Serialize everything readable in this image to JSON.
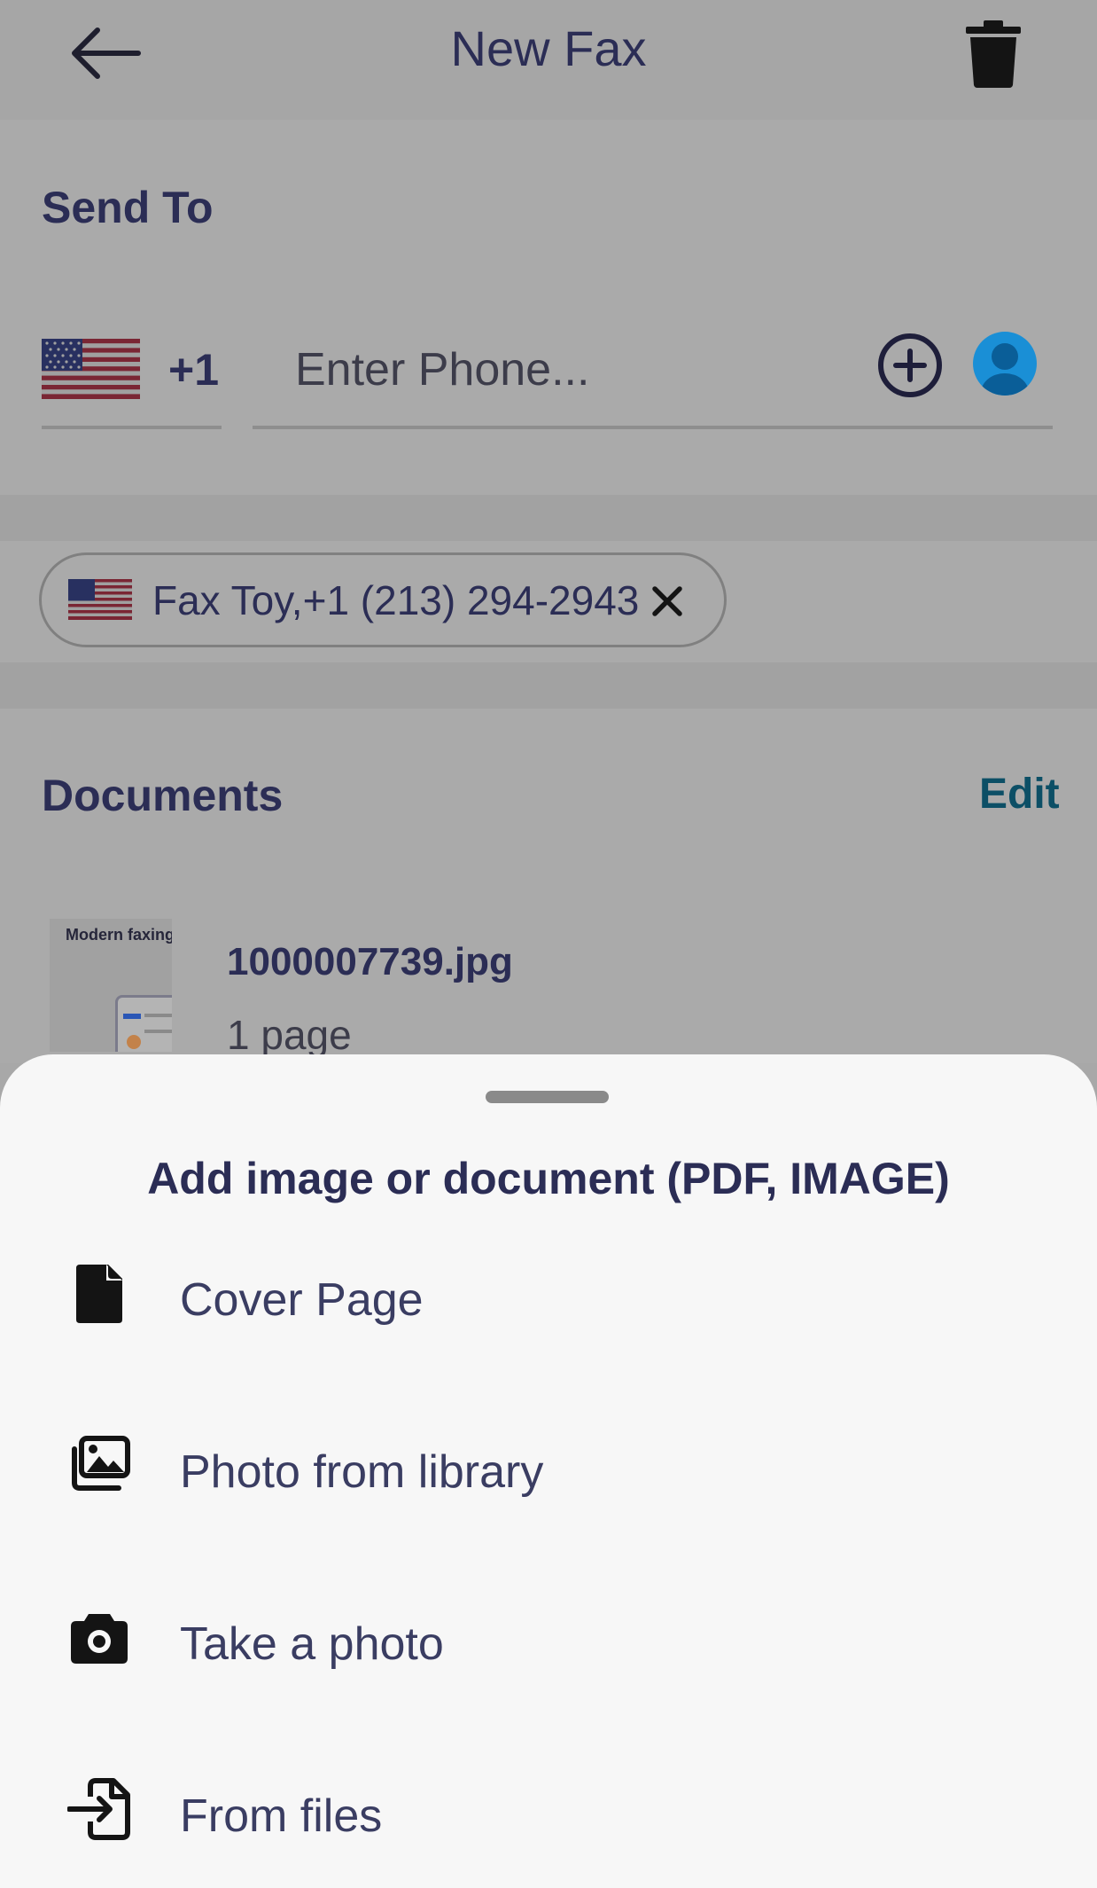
{
  "header": {
    "title": "New Fax",
    "back_icon": "arrow-left-icon",
    "delete_icon": "trash-icon"
  },
  "send_to": {
    "label": "Send To",
    "country_flag": "us-flag-icon",
    "dial_code": "+1",
    "phone_placeholder": "Enter Phone...",
    "add_icon": "plus-circle-icon",
    "contacts_icon": "contact-avatar-icon"
  },
  "recipients": [
    {
      "label": "Fax Toy,+1 (213) 294-2943",
      "flag": "us-flag-icon",
      "remove_icon": "close-icon"
    }
  ],
  "documents": {
    "label": "Documents",
    "edit_label": "Edit",
    "items": [
      {
        "thumbnail_caption": "Modern faxing",
        "name": "1000007739.jpg",
        "pages": "1 page"
      }
    ]
  },
  "sheet": {
    "title": "Add image or document (PDF, IMAGE)",
    "options": [
      {
        "label": "Cover Page",
        "icon": "file-icon"
      },
      {
        "label": "Photo from library",
        "icon": "photo-library-icon"
      },
      {
        "label": "Take a photo",
        "icon": "camera-icon"
      },
      {
        "label": "From files",
        "icon": "file-import-icon"
      }
    ]
  },
  "colors": {
    "primary_text": "#2b2d55",
    "accent_link": "#0c4f66",
    "avatar_blue": "#1a8fd6",
    "sheet_background": "#f7f7f7",
    "overlay_background": "#a8a8a8"
  }
}
